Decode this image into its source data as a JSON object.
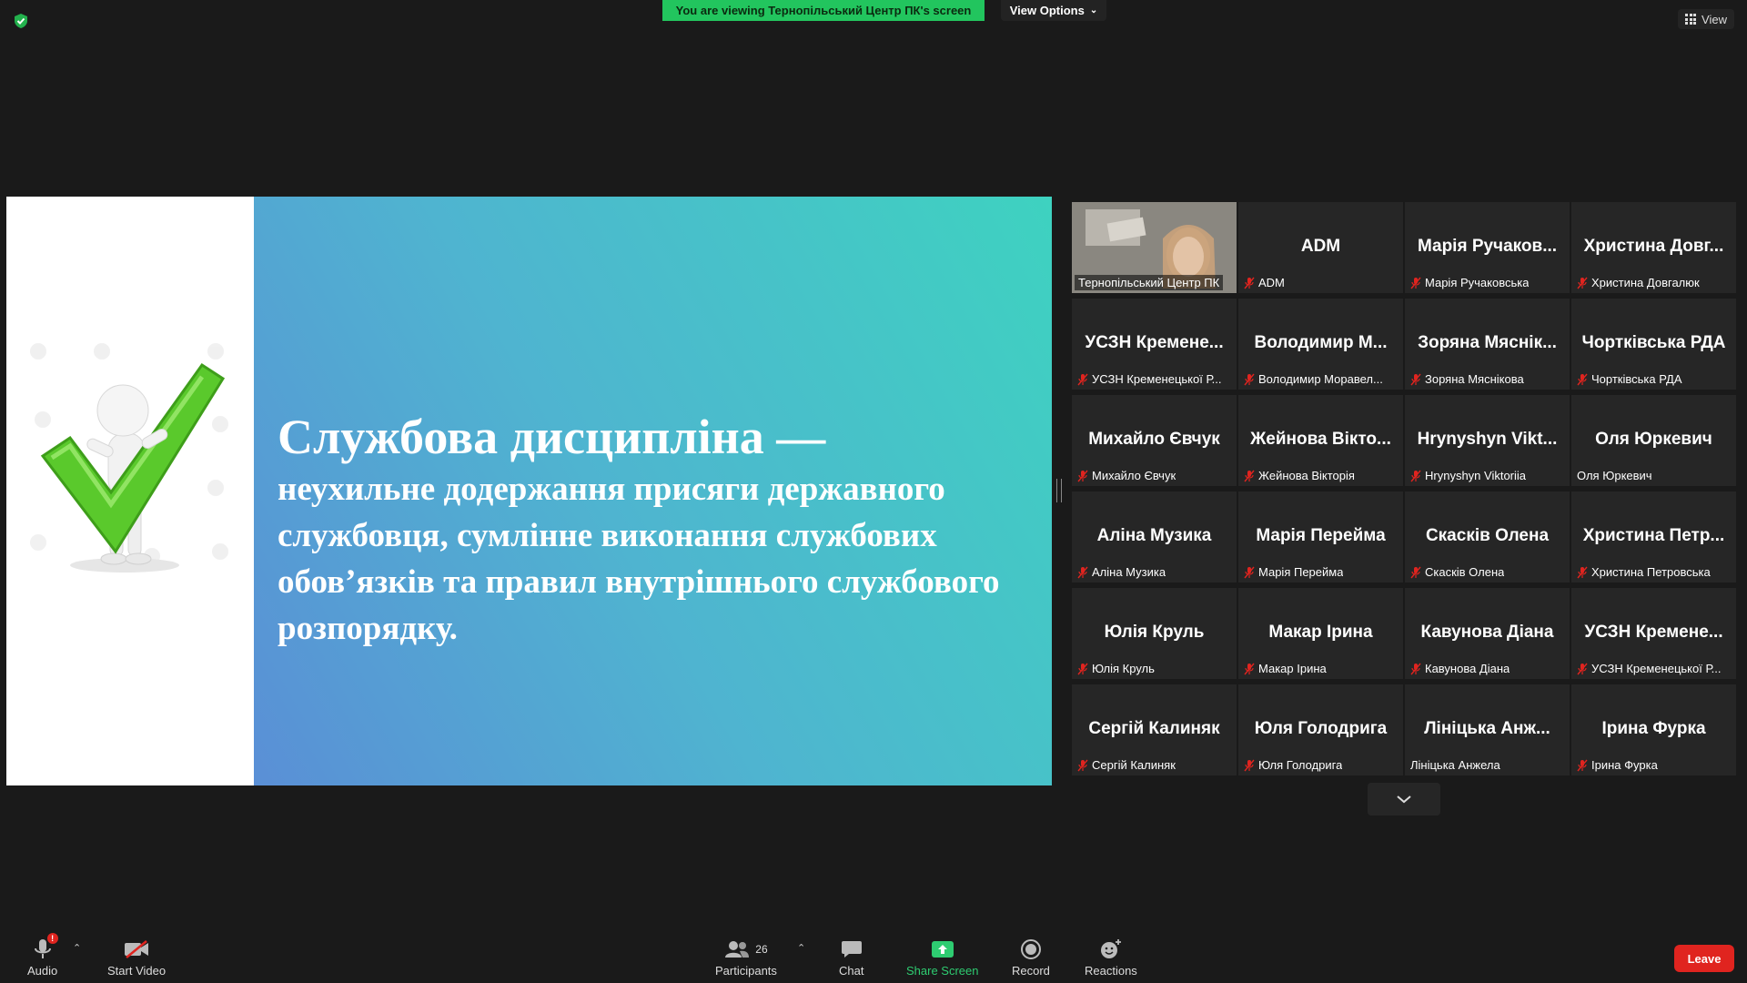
{
  "top": {
    "viewing_banner": "You are viewing Тернопільський Центр ПК's screen",
    "view_options": "View Options",
    "view": "View"
  },
  "slide": {
    "title": "Службова дисципліна —",
    "body": "неухильне додержання присяги державного службовця, сумлінне виконання службових обов’язків та правил внутрішнього службового розпорядку."
  },
  "gallery": [
    {
      "big": "",
      "label": "Тернопільський Центр ПК",
      "muted": false,
      "active": true
    },
    {
      "big": "ADM",
      "label": "ADM",
      "muted": true
    },
    {
      "big": "Марія Ручаков...",
      "label": "Марія Ручаковська",
      "muted": true
    },
    {
      "big": "Христина Довг...",
      "label": "Христина Довгалюк",
      "muted": true
    },
    {
      "big": "УСЗН Кремене...",
      "label": "УСЗН Кременецької Р...",
      "muted": true
    },
    {
      "big": "Володимир М...",
      "label": "Володимир Моравел...",
      "muted": true
    },
    {
      "big": "Зоряна Мяснік...",
      "label": "Зоряна Мяснікова",
      "muted": true
    },
    {
      "big": "Чортківська РДА",
      "label": "Чортківська РДА",
      "muted": true
    },
    {
      "big": "Михайло Євчук",
      "label": "Михайло Євчук",
      "muted": true
    },
    {
      "big": "Жейнова Вікто...",
      "label": "Жейнова Вікторія",
      "muted": true
    },
    {
      "big": "Hrynyshyn Vikt...",
      "label": "Hrynyshyn Viktoriia",
      "muted": true
    },
    {
      "big": "Оля Юркевич",
      "label": "Оля Юркевич",
      "muted": false
    },
    {
      "big": "Аліна Музика",
      "label": "Аліна Музика",
      "muted": true
    },
    {
      "big": "Марія Перейма",
      "label": "Марія Перейма",
      "muted": true
    },
    {
      "big": "Скасків Олена",
      "label": "Скасків Олена",
      "muted": true
    },
    {
      "big": "Христина Петр...",
      "label": "Христина Петровська",
      "muted": true
    },
    {
      "big": "Юлія Круль",
      "label": "Юлія Круль",
      "muted": true
    },
    {
      "big": "Макар Ірина",
      "label": "Макар Ірина",
      "muted": true
    },
    {
      "big": "Кавунова Діана",
      "label": "Кавунова Діана",
      "muted": true
    },
    {
      "big": "УСЗН Кремене...",
      "label": "УСЗН Кременецької Р...",
      "muted": true
    },
    {
      "big": "Сергій Калиняк",
      "label": "Сергій Калиняк",
      "muted": true
    },
    {
      "big": "Юля Голодрига",
      "label": "Юля Голодрига",
      "muted": true
    },
    {
      "big": "Лініцька Анж...",
      "label": "Лініцька Анжела",
      "muted": false
    },
    {
      "big": "Ірина Фурка",
      "label": "Ірина Фурка",
      "muted": true
    }
  ],
  "toolbar": {
    "audio": "Audio",
    "audio_badge": "!",
    "start_video": "Start Video",
    "participants": "Participants",
    "participants_count": "26",
    "chat": "Chat",
    "share_screen": "Share Screen",
    "record": "Record",
    "reactions": "Reactions",
    "leave": "Leave"
  },
  "colors": {
    "banner": "#22c55e",
    "leave": "#e0241f",
    "share": "#2ecc71",
    "active_outline": "#e5e57a"
  }
}
